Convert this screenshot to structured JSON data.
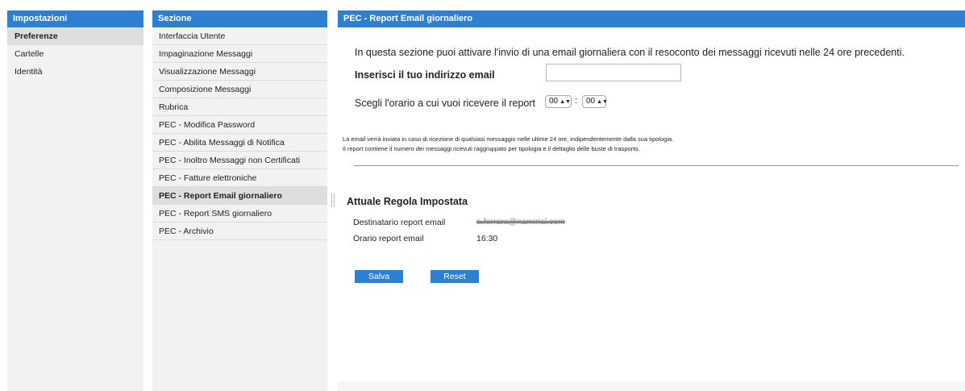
{
  "impostazioni": {
    "title": "Impostazioni",
    "items": [
      {
        "label": "Preferenze",
        "active": true
      },
      {
        "label": "Cartelle",
        "active": false
      },
      {
        "label": "Identità",
        "active": false
      }
    ]
  },
  "sezione": {
    "title": "Sezione",
    "items": [
      {
        "label": "Interfaccia Utente"
      },
      {
        "label": "Impaginazione Messaggi"
      },
      {
        "label": "Visualizzazione Messaggi"
      },
      {
        "label": "Composizione Messaggi"
      },
      {
        "label": "Rubrica"
      },
      {
        "label": "PEC - Modifica Password"
      },
      {
        "label": "PEC - Abilita Messaggi di Notifica"
      },
      {
        "label": "PEC - Inoltro Messaggi non Certificati"
      },
      {
        "label": "PEC - Fatture elettroniche"
      },
      {
        "label": "PEC - Report Email giornaliero",
        "active": true
      },
      {
        "label": "PEC - Report SMS giornaliero"
      },
      {
        "label": "PEC - Archivio"
      }
    ]
  },
  "main": {
    "title": "PEC - Report Email giornaliero",
    "intro": "In questa sezione puoi attivare l'invio di una email giornaliera con il resoconto dei messaggi ricevuti nelle 24 ore precedenti.",
    "email_label": "Inserisci il tuo indirizzo email",
    "email_value": "",
    "time_label": "Scegli l'orario a cui vuoi ricevere il report",
    "hour_value": "00",
    "minute_value": "00",
    "time_separator": ":",
    "note1": "La email verrà inviata in caso di ricezione di qualsiasi messaggio nelle ultime 24 ore, indipendentemente dalla sua tipologia.",
    "note2": "Il report contiene il numero dei messaggi ricevuti raggruppato per tipologia e il dettaglio delle buste di trasporto.",
    "rule_title": "Attuale Regola Impostata",
    "dest_label": "Destinatario report email",
    "dest_value": "a.ferrara@namirial.com",
    "time_report_label": "Orario report email",
    "time_report_value": "16:30",
    "save_label": "Salva",
    "reset_label": "Reset"
  },
  "colors": {
    "header_blue": "#2e7fd0",
    "panel_gray": "#f2f2f2",
    "active_gray": "#dedede"
  }
}
